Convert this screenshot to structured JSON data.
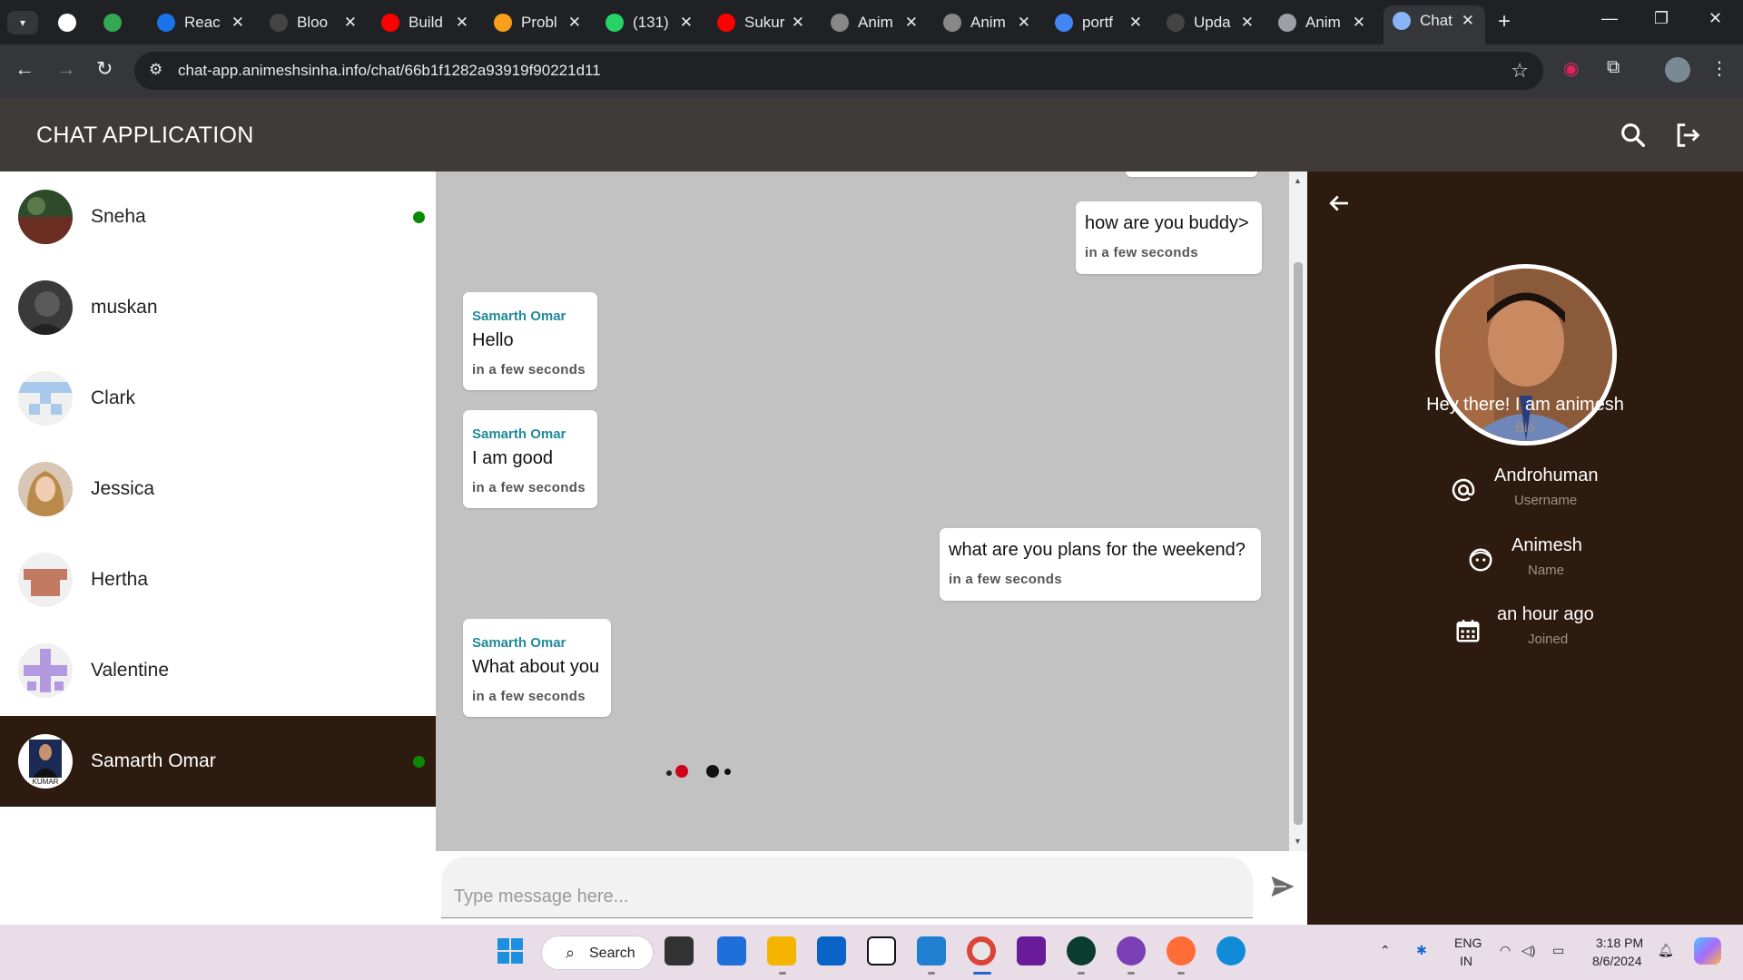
{
  "browser": {
    "tabs": [
      {
        "title": "",
        "favicon": "openai-icon",
        "color": "#ffffff"
      },
      {
        "title": "",
        "favicon": "d-icon",
        "color": "#34a853"
      },
      {
        "title": "Reac",
        "favicon": "react-icon",
        "color": "#1a73e8"
      },
      {
        "title": "Bloo",
        "favicon": "github-icon",
        "color": "#444444"
      },
      {
        "title": "Build",
        "favicon": "youtube-icon",
        "color": "#ff0000"
      },
      {
        "title": "Probl",
        "favicon": "leetcode-icon",
        "color": "#f89f1b"
      },
      {
        "title": "(131)",
        "favicon": "whatsapp-icon",
        "color": "#25d366"
      },
      {
        "title": "Sukur",
        "favicon": "youtube-icon",
        "color": "#ff0000"
      },
      {
        "title": "Anim",
        "favicon": "person-icon",
        "color": "#888888"
      },
      {
        "title": "Anim",
        "favicon": "person-icon",
        "color": "#888888"
      },
      {
        "title": "portf",
        "favicon": "google-icon",
        "color": "#4285f4"
      },
      {
        "title": "Upda",
        "favicon": "github-icon",
        "color": "#444444"
      },
      {
        "title": "Anim",
        "favicon": "globe-icon",
        "color": "#9aa0a6"
      },
      {
        "title": "Chat",
        "favicon": "chat-icon",
        "color": "#8ab4f8"
      }
    ],
    "url": "chat-app.animeshsinha.info/chat/66b1f1282a93919f90221d11"
  },
  "app": {
    "title": "CHAT APPLICATION"
  },
  "contacts": [
    {
      "name": "Sneha",
      "online": true,
      "selected": false,
      "avatar": "photo-forest"
    },
    {
      "name": "muskan",
      "online": false,
      "selected": false,
      "avatar": "photo-dark"
    },
    {
      "name": "Clark",
      "online": false,
      "selected": false,
      "avatar": "identicon-blue"
    },
    {
      "name": "Jessica",
      "online": false,
      "selected": false,
      "avatar": "photo-portrait"
    },
    {
      "name": "Hertha",
      "online": false,
      "selected": false,
      "avatar": "identicon-brown"
    },
    {
      "name": "Valentine",
      "online": false,
      "selected": false,
      "avatar": "identicon-purple"
    },
    {
      "name": "Samarth Omar",
      "online": true,
      "selected": true,
      "avatar": "photo-kumar"
    }
  ],
  "avatar_overlay_text": "KUMAR",
  "messages": [
    {
      "mine": true,
      "sender": "",
      "text": "how are you buddy>",
      "time": "in a few seconds"
    },
    {
      "mine": false,
      "sender": "Samarth Omar",
      "text": "Hello",
      "time": "in a few seconds"
    },
    {
      "mine": false,
      "sender": "Samarth Omar",
      "text": "I am good",
      "time": "in a few seconds"
    },
    {
      "mine": true,
      "sender": "",
      "text": "what are you plans for the weekend?",
      "time": "in a few seconds"
    },
    {
      "mine": false,
      "sender": "Samarth Omar",
      "text": "What about you",
      "time": "in a few seconds"
    }
  ],
  "composer": {
    "placeholder": "Type message here..."
  },
  "profile": {
    "bio": "Hey there! I am animesh",
    "bio_label": "Bio",
    "username": "Androhuman",
    "username_label": "Username",
    "name": "Animesh",
    "name_label": "Name",
    "joined": "an hour ago",
    "joined_label": "Joined"
  },
  "taskbar": {
    "search_label": "Search",
    "lang_line1": "ENG",
    "lang_line2": "IN",
    "time": "3:18 PM",
    "date": "8/6/2024"
  },
  "colors": {
    "header_bg": "#3e3b39",
    "accent_dark": "#2e1b10",
    "chat_bg": "#c2c2c2",
    "sender_name": "#1f8a99",
    "online": "#0a8a00"
  }
}
